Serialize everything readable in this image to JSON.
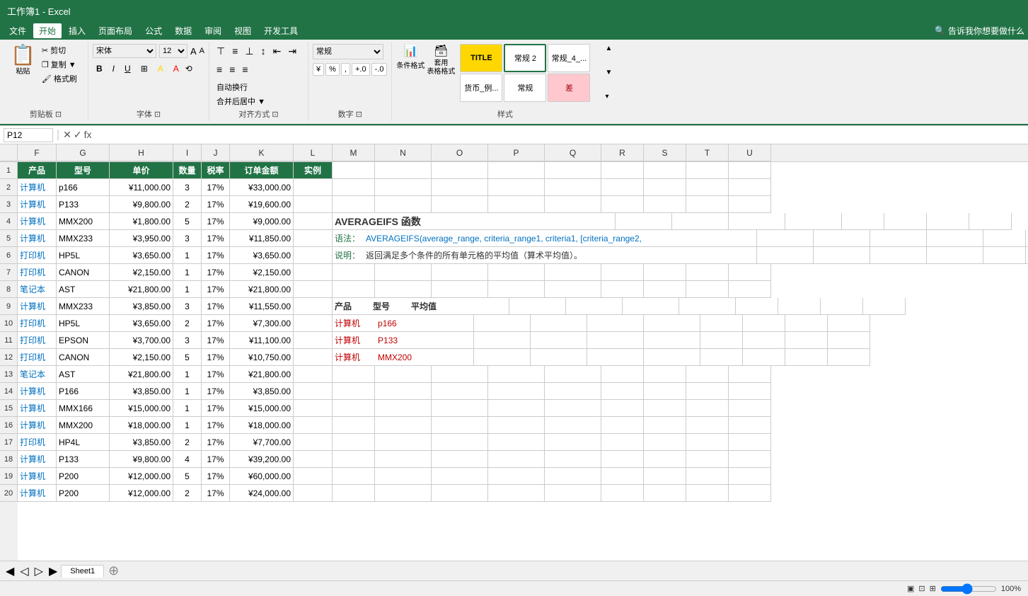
{
  "titleBar": {
    "text": "工作簿1 - Excel"
  },
  "menuBar": {
    "items": [
      "文件",
      "开始",
      "插入",
      "页面布局",
      "公式",
      "数据",
      "审阅",
      "视图",
      "开发工具"
    ],
    "activeItem": "开始",
    "search": "告诉我你想要做什么"
  },
  "ribbon": {
    "groups": {
      "clipboard": {
        "label": "剪贴板",
        "paste": "粘贴",
        "cut": "✂ 剪切",
        "copy": "❒ 复制 ▼",
        "formatPainter": "🖌 格式刷"
      },
      "font": {
        "label": "字体",
        "fontName": "宋体",
        "fontSize": "12",
        "bold": "B",
        "italic": "I",
        "underline": "U",
        "border": "⊞",
        "fillColor": "A",
        "fontColor": "A"
      },
      "alignment": {
        "label": "对齐方式",
        "autoWrap": "自动换行",
        "merge": "合并后居中 ▼"
      },
      "number": {
        "label": "数字",
        "format": "常规",
        "percent": "%",
        "comma": ",",
        "increase": "+.0",
        "decrease": "-.0"
      },
      "styles": {
        "label": "样式",
        "items": [
          {
            "name": "TITLE",
            "style": "title"
          },
          {
            "name": "常规 2",
            "style": "normal2"
          },
          {
            "name": "常规_4_...",
            "style": "normal4"
          },
          {
            "name": "货币_例...",
            "style": "currency"
          },
          {
            "name": "常规",
            "style": "normal"
          },
          {
            "name": "差",
            "style": "bad"
          }
        ],
        "conditionalFormat": "条件格式",
        "formatAsTable": "套用\n表格格式"
      }
    }
  },
  "formulaBar": {
    "cellRef": "P12",
    "formula": ""
  },
  "columns": [
    "F",
    "G",
    "H",
    "I",
    "J",
    "K",
    "L",
    "M",
    "N",
    "O",
    "P",
    "Q",
    "R",
    "S",
    "T",
    "U"
  ],
  "headerRow": {
    "cells": [
      "产品",
      "型号",
      "单价",
      "数量",
      "税率",
      "订单金额",
      "实例",
      "",
      "",
      "",
      "",
      "",
      "",
      "",
      "",
      ""
    ]
  },
  "dataRows": [
    {
      "rowNum": 2,
      "cells": [
        "计算机",
        "p166",
        "¥11,000.00",
        "3",
        "17%",
        "¥33,000.00",
        "",
        "",
        "",
        "",
        "",
        "",
        "",
        "",
        "",
        ""
      ]
    },
    {
      "rowNum": 3,
      "cells": [
        "计算机",
        "P133",
        "¥9,800.00",
        "2",
        "17%",
        "¥19,600.00",
        "",
        "",
        "",
        "",
        "",
        "",
        "",
        "",
        "",
        ""
      ]
    },
    {
      "rowNum": 4,
      "cells": [
        "计算机",
        "MMX200",
        "¥1,800.00",
        "5",
        "17%",
        "¥9,000.00",
        "",
        "",
        "",
        "",
        "",
        "",
        "",
        "",
        "",
        ""
      ]
    },
    {
      "rowNum": 5,
      "cells": [
        "计算机",
        "MMX233",
        "¥3,950.00",
        "3",
        "17%",
        "¥11,850.00",
        "",
        "",
        "",
        "",
        "",
        "",
        "",
        "",
        "",
        ""
      ]
    },
    {
      "rowNum": 6,
      "cells": [
        "打印机",
        "HP5L",
        "¥3,650.00",
        "1",
        "17%",
        "¥3,650.00",
        "",
        "",
        "",
        "",
        "",
        "",
        "",
        "",
        "",
        ""
      ]
    },
    {
      "rowNum": 7,
      "cells": [
        "打印机",
        "CANON",
        "¥2,150.00",
        "1",
        "17%",
        "¥2,150.00",
        "",
        "",
        "",
        "",
        "",
        "",
        "",
        "",
        "",
        ""
      ]
    },
    {
      "rowNum": 8,
      "cells": [
        "笔记本",
        "AST",
        "¥21,800.00",
        "1",
        "17%",
        "¥21,800.00",
        "",
        "",
        "",
        "",
        "",
        "",
        "",
        "",
        "",
        ""
      ]
    },
    {
      "rowNum": 9,
      "cells": [
        "计算机",
        "MMX233",
        "¥3,850.00",
        "3",
        "17%",
        "¥11,550.00",
        "",
        "",
        "",
        "",
        "",
        "",
        "",
        "",
        "",
        ""
      ]
    },
    {
      "rowNum": 10,
      "cells": [
        "打印机",
        "HP5L",
        "¥3,650.00",
        "2",
        "17%",
        "¥7,300.00",
        "",
        "",
        "",
        "",
        "",
        "",
        "",
        "",
        "",
        ""
      ]
    },
    {
      "rowNum": 11,
      "cells": [
        "打印机",
        "EPSON",
        "¥3,700.00",
        "3",
        "17%",
        "¥11,100.00",
        "",
        "",
        "",
        "",
        "",
        "",
        "",
        "",
        "",
        ""
      ]
    },
    {
      "rowNum": 12,
      "cells": [
        "打印机",
        "CANON",
        "¥2,150.00",
        "5",
        "17%",
        "¥10,750.00",
        "",
        "",
        "",
        "",
        "",
        "",
        "",
        "",
        "",
        ""
      ]
    },
    {
      "rowNum": 13,
      "cells": [
        "笔记本",
        "AST",
        "¥21,800.00",
        "1",
        "17%",
        "¥21,800.00",
        "",
        "",
        "",
        "",
        "",
        "",
        "",
        "",
        "",
        ""
      ]
    },
    {
      "rowNum": 14,
      "cells": [
        "计算机",
        "P166",
        "¥3,850.00",
        "1",
        "17%",
        "¥3,850.00",
        "",
        "",
        "",
        "",
        "",
        "",
        "",
        "",
        "",
        ""
      ]
    },
    {
      "rowNum": 15,
      "cells": [
        "计算机",
        "MMX166",
        "¥15,000.00",
        "1",
        "17%",
        "¥15,000.00",
        "",
        "",
        "",
        "",
        "",
        "",
        "",
        "",
        "",
        ""
      ]
    },
    {
      "rowNum": 16,
      "cells": [
        "计算机",
        "MMX200",
        "¥18,000.00",
        "1",
        "17%",
        "¥18,000.00",
        "",
        "",
        "",
        "",
        "",
        "",
        "",
        "",
        "",
        ""
      ]
    },
    {
      "rowNum": 17,
      "cells": [
        "打印机",
        "HP4L",
        "¥3,850.00",
        "2",
        "17%",
        "¥7,700.00",
        "",
        "",
        "",
        "",
        "",
        "",
        "",
        "",
        "",
        ""
      ]
    },
    {
      "rowNum": 18,
      "cells": [
        "计算机",
        "P133",
        "¥9,800.00",
        "4",
        "17%",
        "¥39,200.00",
        "",
        "",
        "",
        "",
        "",
        "",
        "",
        "",
        "",
        ""
      ]
    },
    {
      "rowNum": 19,
      "cells": [
        "计算机",
        "P200",
        "¥12,000.00",
        "5",
        "17%",
        "¥60,000.00",
        "",
        "",
        "",
        "",
        "",
        "",
        "",
        "",
        "",
        ""
      ]
    },
    {
      "rowNum": 20,
      "cells": [
        "计算机",
        "P200",
        "¥12,000.00",
        "2",
        "17%",
        "¥24,000.00",
        "",
        "",
        "",
        "",
        "",
        "",
        "",
        "",
        "",
        ""
      ]
    }
  ],
  "infoPanel": {
    "title": "AVERAGEIFS 函数",
    "syntax_label": "语法：",
    "syntax_text": "AVERAGEIFS(average_range, criteria_range1, criteria1, [criteria_range2,",
    "desc_label": "说明：",
    "desc_text": "返回满足多个条件的所有单元格的平均值（算术平均值）。",
    "tableTitle": {
      "col1": "产品",
      "col2": "型号",
      "col3": "平均值"
    },
    "tableRows": [
      {
        "col1": "计算机",
        "col2": "p166"
      },
      {
        "col1": "计算机",
        "col2": "P133"
      },
      {
        "col1": "计算机",
        "col2": "MMX200"
      }
    ]
  },
  "bottomTabs": {
    "tabs": [
      "Sheet1"
    ],
    "activeTab": "Sheet1"
  },
  "statusBar": {
    "text": ""
  }
}
